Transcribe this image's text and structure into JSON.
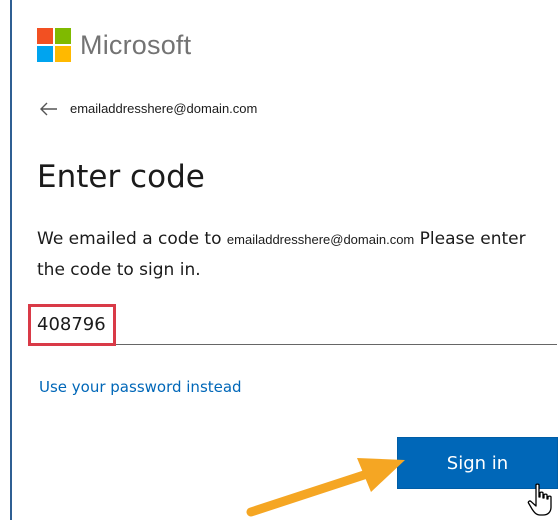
{
  "brand": {
    "name": "Microsoft",
    "logo_colors": [
      "#f25022",
      "#7fba00",
      "#00a4ef",
      "#ffb900"
    ]
  },
  "account": {
    "email": "emailaddresshere@domain.com"
  },
  "page": {
    "title": "Enter code",
    "description_prefix": "We emailed a code to",
    "description_email": "emailaddresshere@domain.com",
    "description_suffix": "Please enter the code to sign in."
  },
  "code_input": {
    "value": "408796"
  },
  "links": {
    "use_password": "Use your password instead"
  },
  "buttons": {
    "sign_in": "Sign in"
  },
  "colors": {
    "primary": "#0067b8",
    "link": "#0067b8",
    "annotation_box": "#d93a47",
    "annotation_arrow": "#f5a623"
  },
  "icons": {
    "back": "back-arrow-icon",
    "pointer": "hand-pointer-icon"
  }
}
